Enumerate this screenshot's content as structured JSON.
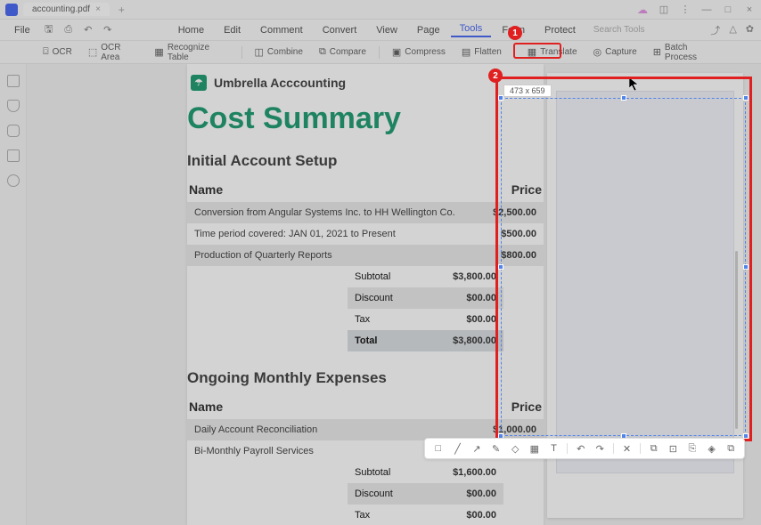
{
  "titlebar": {
    "tab_name": "accounting.pdf"
  },
  "menubar": {
    "file": "File",
    "items": [
      "Home",
      "Edit",
      "Comment",
      "Convert",
      "View",
      "Page",
      "Tools",
      "Form",
      "Protect"
    ],
    "active_index": 6,
    "search_placeholder": "Search Tools"
  },
  "toolbar": {
    "ocr": "OCR",
    "ocr_area": "OCR Area",
    "recognize_table": "Recognize Table",
    "combine": "Combine",
    "compare": "Compare",
    "compress": "Compress",
    "flatten": "Flatten",
    "translate": "Translate",
    "capture": "Capture",
    "batch_process": "Batch Process"
  },
  "doc": {
    "brand_name": "Umbrella Acccounting",
    "title": "Cost Summary",
    "section1": {
      "heading": "Initial Account Setup",
      "col_name": "Name",
      "col_price": "Price",
      "rows": [
        {
          "label": "Conversion from Angular Systems Inc. to HH Wellington Co.",
          "val": "$2,500.00"
        },
        {
          "label": "Time period covered: JAN 01, 2021 to Present",
          "val": "$500.00"
        },
        {
          "label": "Production of Quarterly Reports",
          "val": "$800.00"
        }
      ],
      "subtotal_label": "Subtotal",
      "subtotal_val": "$3,800.00",
      "discount_label": "Discount",
      "discount_val": "$00.00",
      "tax_label": "Tax",
      "tax_val": "$00.00",
      "total_label": "Total",
      "total_val": "$3,800.00"
    },
    "section2": {
      "heading": "Ongoing Monthly Expenses",
      "col_name": "Name",
      "col_price": "Price",
      "rows": [
        {
          "label": "Daily Account Reconciliation",
          "val": "$1,000.00"
        },
        {
          "label": "Bi-Monthly Payroll Services",
          "val": ""
        }
      ],
      "subtotal_label": "Subtotal",
      "subtotal_val": "$1,600.00",
      "discount_label": "Discount",
      "discount_val": "$00.00",
      "tax_label": "Tax",
      "tax_val": "$00.00"
    }
  },
  "capture": {
    "size_label": "473 x 659"
  },
  "callouts": {
    "num1": "1",
    "num2": "2"
  }
}
